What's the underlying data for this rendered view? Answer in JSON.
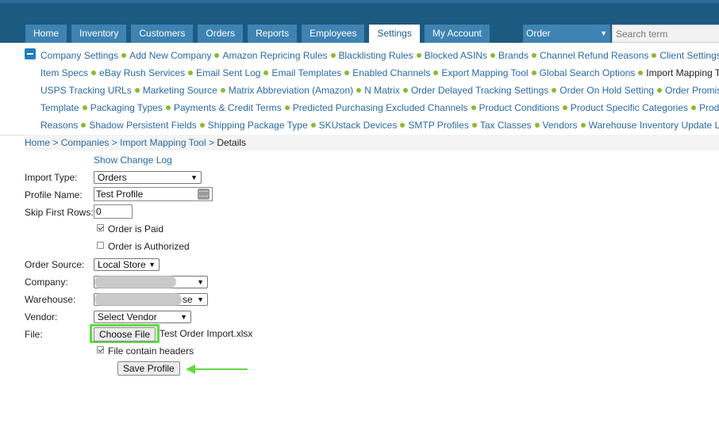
{
  "nav": {
    "tabs": [
      "Home",
      "Inventory",
      "Customers",
      "Orders",
      "Reports",
      "Employees",
      "Settings",
      "My Account"
    ],
    "active_tab": "Settings",
    "search_scope": "Order",
    "search_placeholder": "Search term"
  },
  "settings_links": {
    "line1": [
      "Company Settings",
      "Add New Company",
      "Amazon Repricing Rules",
      "Blacklisting Rules",
      "Blocked ASINs",
      "Brands",
      "Channel Refund Reasons",
      "Client Settings"
    ],
    "line2": [
      "Item Specs",
      "eBay Rush Services",
      "Email Sent Log",
      "Email Templates",
      "Enabled Channels",
      "Export Mapping Tool",
      "Global Search Options",
      "Import Mapping T"
    ],
    "line3": [
      "USPS Tracking URLs",
      "Marketing Source",
      "Matrix Abbreviation (Amazon)",
      "N Matrix",
      "Order Delayed Tracking Settings",
      "Order On Hold Setting",
      "Order Promis"
    ],
    "line4": [
      "Template",
      "Packaging Types",
      "Payments & Credit Terms",
      "Predicted Purchasing Excluded Channels",
      "Product Conditions",
      "Product Specific Categories",
      "Prod"
    ],
    "line5": [
      "Reasons",
      "Shadow Persistent Fields",
      "Shipping Package Type",
      "SKUstack Devices",
      "SMTP Profiles",
      "Tax Classes",
      "Vendors",
      "Warehouse Inventory Update L"
    ]
  },
  "breadcrumb": {
    "home": "Home",
    "sep": ">",
    "companies": "Companies",
    "tool": "Import Mapping Tool",
    "current": "Details"
  },
  "form": {
    "show_change_log": "Show Change Log",
    "import_type_label": "Import Type:",
    "import_type_value": "Orders",
    "profile_name_label": "Profile Name:",
    "profile_name_value": "Test Profile",
    "skip_rows_label": "Skip First Rows:",
    "skip_rows_value": "0",
    "order_paid_label": "Order is Paid",
    "order_paid_checked": true,
    "order_authorized_label": "Order is Authorized",
    "order_authorized_checked": false,
    "order_source_label": "Order Source:",
    "order_source_value": "Local Store",
    "company_label": "Company:",
    "warehouse_label": "Warehouse:",
    "warehouse_visible_suffix": "se",
    "vendor_label": "Vendor:",
    "vendor_value": "Select Vendor",
    "file_label": "File:",
    "choose_file_label": "Choose File",
    "file_name": "Test Order Import.xlsx",
    "headers_label": "File contain headers",
    "headers_checked": true,
    "save_label": "Save Profile"
  },
  "colors": {
    "header_bg": "#1c5a82",
    "tab_bg": "#3f83b2",
    "link": "#2a6aa3",
    "bullet": "#8aba32",
    "annotation": "#5ddc3c"
  }
}
